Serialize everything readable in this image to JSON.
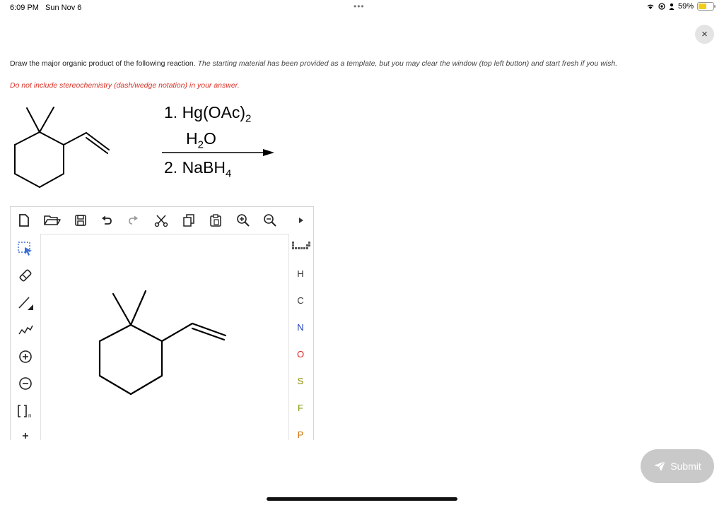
{
  "status_bar": {
    "time": "6:09 PM",
    "date": "Sun Nov 6",
    "battery_percent": "59%",
    "battery_level": 0.59
  },
  "close_button": {
    "label": "×"
  },
  "question": {
    "main": "Draw the major organic product of the following reaction.",
    "italic": "The starting material has been provided as a template, but you may clear the window (top left button) and start fresh if you wish.",
    "instruction": "Do not include stereochemistry (dash/wedge notation) in your answer."
  },
  "reaction": {
    "step1_prefix": "1. Hg(OAc)",
    "step1_sub": "2",
    "step2_prefix": "H",
    "step2_sub": "2",
    "step2_suffix": "O",
    "step3_prefix": "2. NaBH",
    "step3_sub": "4"
  },
  "editor": {
    "top_tools": [
      "new-document-icon",
      "open-folder-icon",
      "save-icon",
      "undo-icon",
      "redo-icon",
      "cut-icon",
      "copy-icon",
      "paste-icon",
      "zoom-in-icon",
      "zoom-out-icon",
      "expand-arrow-icon"
    ],
    "left_tools": [
      "select-lasso-icon",
      "eraser-icon",
      "bond-tool-icon",
      "chain-tool-icon",
      "charge-plus-icon",
      "charge-minus-icon",
      "bracket-tool-icon",
      "radical-tool-icon"
    ],
    "bracket_subscript": "n",
    "atoms": [
      {
        "symbol": "H",
        "color": "#333333"
      },
      {
        "symbol": "C",
        "color": "#333333"
      },
      {
        "symbol": "N",
        "color": "#1f3fbf"
      },
      {
        "symbol": "O",
        "color": "#e02020"
      },
      {
        "symbol": "S",
        "color": "#8a8a00"
      },
      {
        "symbol": "F",
        "color": "#7a9a00"
      },
      {
        "symbol": "P",
        "color": "#d07000"
      }
    ]
  },
  "submit_button": {
    "label": "Submit"
  }
}
